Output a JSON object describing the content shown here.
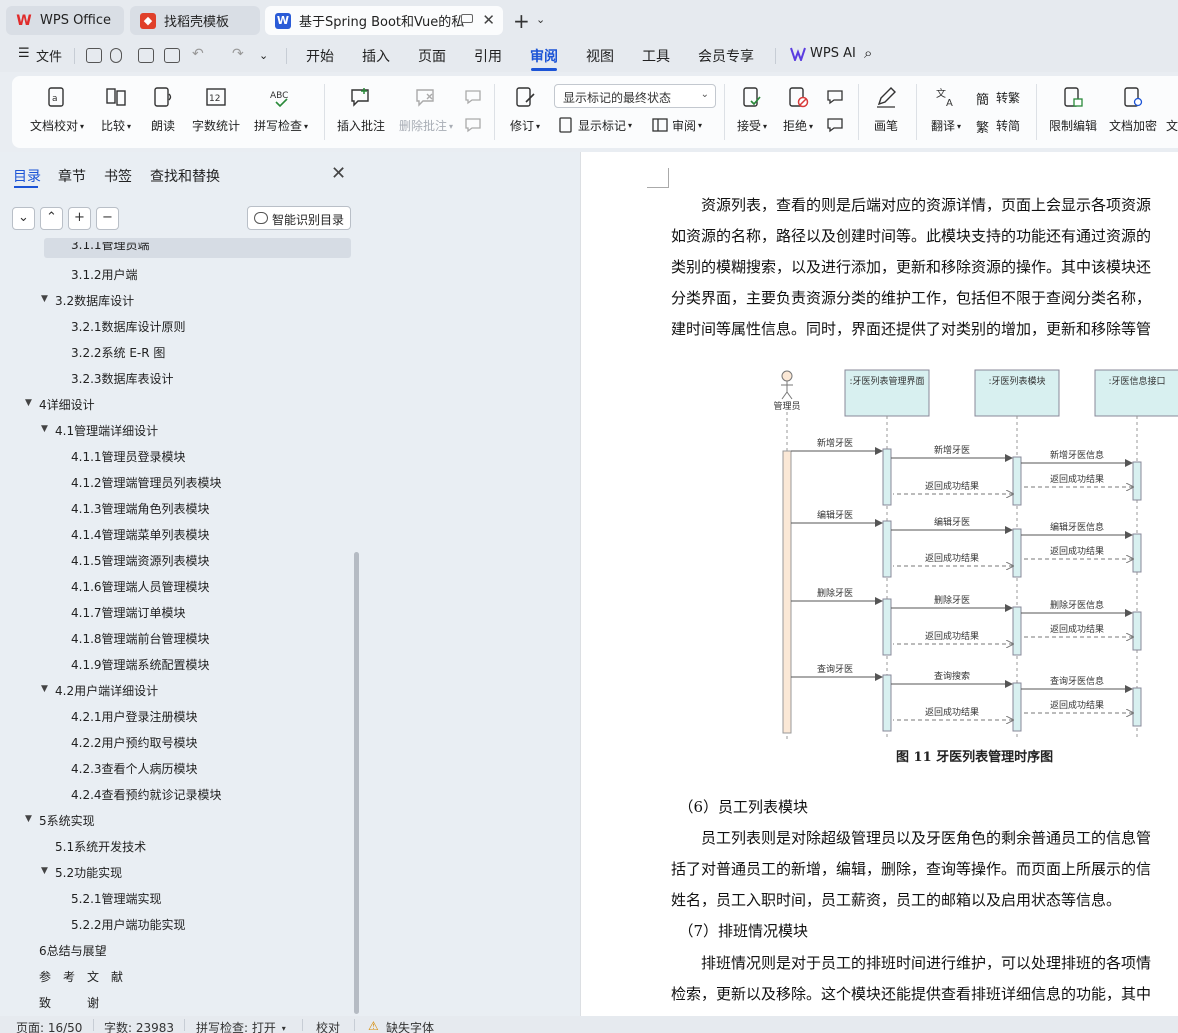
{
  "tabs": [
    {
      "label": "WPS Office",
      "icon": "wps-logo-icon"
    },
    {
      "label": "找稻壳模板",
      "icon": "daoke-icon"
    },
    {
      "label": "基于Spring Boot和Vue的私人",
      "icon": "writer-doc-icon"
    }
  ],
  "menu": {
    "file": "文件",
    "items": [
      "开始",
      "插入",
      "页面",
      "引用",
      "审阅",
      "视图",
      "工具",
      "会员专享"
    ],
    "active": "审阅",
    "wps_ai": "WPS AI"
  },
  "ribbon": {
    "doc_check": "文档校对",
    "compare": "比较",
    "read_aloud": "朗读",
    "word_count": "字数统计",
    "spell_check": "拼写检查",
    "insert_comment": "插入批注",
    "delete_comment": "删除批注",
    "track_changes": "修订",
    "markup_select": "显示标记的最终状态",
    "show_markup": "显示标记",
    "review": "审阅",
    "accept": "接受",
    "reject": "拒绝",
    "pen": "画笔",
    "translate": "翻译",
    "to_traditional": "转繁",
    "to_simplified": "转简",
    "restrict_edit": "限制编辑",
    "encrypt": "文档加密",
    "overflow": "文"
  },
  "sidebar": {
    "tabs": [
      "目录",
      "章节",
      "书签",
      "查找和替换"
    ],
    "smart_toc": "智能识别目录",
    "toc": [
      {
        "level": 3,
        "label": "3.1.1管理员端",
        "selected": true
      },
      {
        "level": 3,
        "label": "3.1.2用户端"
      },
      {
        "level": 2,
        "label": "3.2数据库设计",
        "expanded": true
      },
      {
        "level": 3,
        "label": "3.2.1数据库设计原则"
      },
      {
        "level": 3,
        "label": "3.2.2系统 E-R 图"
      },
      {
        "level": 3,
        "label": "3.2.3数据库表设计"
      },
      {
        "level": 1,
        "label": "4详细设计",
        "expanded": true
      },
      {
        "level": 2,
        "label": "4.1管理端详细设计",
        "expanded": true
      },
      {
        "level": 3,
        "label": "4.1.1管理员登录模块"
      },
      {
        "level": 3,
        "label": "4.1.2管理端管理员列表模块"
      },
      {
        "level": 3,
        "label": "4.1.3管理端角色列表模块"
      },
      {
        "level": 3,
        "label": "4.1.4管理端菜单列表模块"
      },
      {
        "level": 3,
        "label": "4.1.5管理端资源列表模块"
      },
      {
        "level": 3,
        "label": "4.1.6管理端人员管理模块"
      },
      {
        "level": 3,
        "label": "4.1.7管理端订单模块"
      },
      {
        "level": 3,
        "label": "4.1.8管理端前台管理模块"
      },
      {
        "level": 3,
        "label": "4.1.9管理端系统配置模块"
      },
      {
        "level": 2,
        "label": "4.2用户端详细设计",
        "expanded": true
      },
      {
        "level": 3,
        "label": "4.2.1用户登录注册模块"
      },
      {
        "level": 3,
        "label": "4.2.2用户预约取号模块"
      },
      {
        "level": 3,
        "label": "4.2.3查看个人病历模块"
      },
      {
        "level": 3,
        "label": "4.2.4查看预约就诊记录模块"
      },
      {
        "level": 1,
        "label": "5系统实现",
        "expanded": true
      },
      {
        "level": 2,
        "label": "5.1系统开发技术"
      },
      {
        "level": 2,
        "label": "5.2功能实现",
        "expanded": true
      },
      {
        "level": 3,
        "label": "5.2.1管理端实现"
      },
      {
        "level": 3,
        "label": "5.2.2用户端功能实现"
      },
      {
        "level": 1,
        "label": "6总结与展望"
      },
      {
        "level": 1,
        "label": "参　考　文　献"
      },
      {
        "level": 1,
        "label": "致　　　谢"
      }
    ]
  },
  "document": {
    "paragraphs_top": [
      "　　资源列表，查看的则是后端对应的资源详情，页面上会显示各项资源",
      "如资源的名称，路径以及创建时间等。此模块支持的功能还有通过资源的",
      "类别的模糊搜索，以及进行添加，更新和移除资源的操作。其中该模块还",
      "分类界面，主要负责资源分类的维护工作，包括但不限于查阅分类名称，",
      "建时间等属性信息。同时，界面还提供了对类别的增加，更新和移除等管"
    ],
    "diagram": {
      "actor": "管理员",
      "lifelines": [
        ":牙医列表管理界面",
        ":牙医列表模块",
        ":牙医信息接口"
      ],
      "groups": [
        {
          "actor_msg": "新增牙医",
          "ui_msg": "新增牙医",
          "api_msg": "新增牙医信息",
          "ret_api": "返回成功结果",
          "ret_ui": "返回成功结果"
        },
        {
          "actor_msg": "编辑牙医",
          "ui_msg": "编辑牙医",
          "api_msg": "编辑牙医信息",
          "ret_api": "返回成功结果",
          "ret_ui": "返回成功结果"
        },
        {
          "actor_msg": "删除牙医",
          "ui_msg": "删除牙医",
          "api_msg": "删除牙医信息",
          "ret_api": "返回成功结果",
          "ret_ui": "返回成功结果"
        },
        {
          "actor_msg": "查询牙医",
          "ui_msg": "查询搜索",
          "api_msg": "查询牙医信息",
          "ret_api": "返回成功结果",
          "ret_ui": "返回成功结果"
        }
      ]
    },
    "caption": "图 11  牙医列表管理时序图",
    "paragraphs_bottom": [
      "　（6）员工列表模块",
      "　　员工列表则是对除超级管理员以及牙医角色的剩余普通员工的信息管",
      "括了对普通员工的新增，编辑，删除，查询等操作。而页面上所展示的信",
      "姓名，员工入职时间，员工薪资，员工的邮箱以及启用状态等信息。",
      "　（7）排班情况模块",
      "　　排班情况则是对于员工的排班时间进行维护，可以处理排班的各项情",
      "检索，更新以及移除。这个模块还能提供查看排班详细信息的功能，其中"
    ]
  },
  "status": {
    "page": "页面: 16/50",
    "words": "字数: 23983",
    "spell": "拼写检查: 打开",
    "proof": "校对",
    "missing_font": "缺失字体"
  },
  "colors": {
    "accent": "#1c54d6",
    "lifeline_fill": "#d8f0f0",
    "actor_bar": "#fbe8d6"
  }
}
